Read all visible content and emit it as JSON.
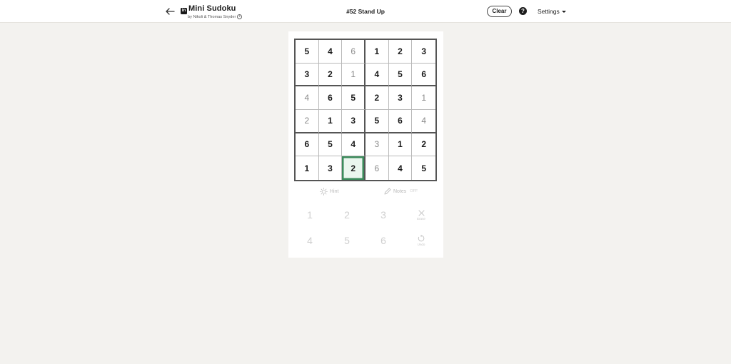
{
  "header": {
    "title": "Mini Sudoku",
    "byline": "by Nikoli & Thomas Snyder",
    "puzzle_title": "#52 Stand Up",
    "clear_label": "Clear",
    "help_label": "?",
    "settings_label": "Settings",
    "brand_logo": "in"
  },
  "board": {
    "rows": [
      [
        {
          "v": "5",
          "t": "given"
        },
        {
          "v": "4",
          "t": "given"
        },
        {
          "v": "6",
          "t": "entered"
        },
        {
          "v": "1",
          "t": "given"
        },
        {
          "v": "2",
          "t": "given"
        },
        {
          "v": "3",
          "t": "given"
        }
      ],
      [
        {
          "v": "3",
          "t": "given"
        },
        {
          "v": "2",
          "t": "given"
        },
        {
          "v": "1",
          "t": "entered"
        },
        {
          "v": "4",
          "t": "given"
        },
        {
          "v": "5",
          "t": "given"
        },
        {
          "v": "6",
          "t": "given"
        }
      ],
      [
        {
          "v": "4",
          "t": "entered"
        },
        {
          "v": "6",
          "t": "given"
        },
        {
          "v": "5",
          "t": "given"
        },
        {
          "v": "2",
          "t": "given"
        },
        {
          "v": "3",
          "t": "given"
        },
        {
          "v": "1",
          "t": "entered"
        }
      ],
      [
        {
          "v": "2",
          "t": "entered"
        },
        {
          "v": "1",
          "t": "given"
        },
        {
          "v": "3",
          "t": "given"
        },
        {
          "v": "5",
          "t": "given"
        },
        {
          "v": "6",
          "t": "given"
        },
        {
          "v": "4",
          "t": "entered"
        }
      ],
      [
        {
          "v": "6",
          "t": "given"
        },
        {
          "v": "5",
          "t": "given"
        },
        {
          "v": "4",
          "t": "given"
        },
        {
          "v": "3",
          "t": "entered"
        },
        {
          "v": "1",
          "t": "given"
        },
        {
          "v": "2",
          "t": "given"
        }
      ],
      [
        {
          "v": "1",
          "t": "given"
        },
        {
          "v": "3",
          "t": "given"
        },
        {
          "v": "2",
          "t": "selected"
        },
        {
          "v": "6",
          "t": "entered"
        },
        {
          "v": "4",
          "t": "given"
        },
        {
          "v": "5",
          "t": "given"
        }
      ]
    ]
  },
  "tools": {
    "hint_label": "Hint",
    "notes_label": "Notes",
    "notes_state": "OFF"
  },
  "keypad": {
    "digits": [
      "1",
      "2",
      "3",
      "4",
      "5",
      "6"
    ],
    "erase_label": "Erase",
    "undo_label": "Undo"
  },
  "colors": {
    "selected_border": "#3b8a5b",
    "selected_fill": "#eaf6ee",
    "background": "#f3f2ef"
  }
}
